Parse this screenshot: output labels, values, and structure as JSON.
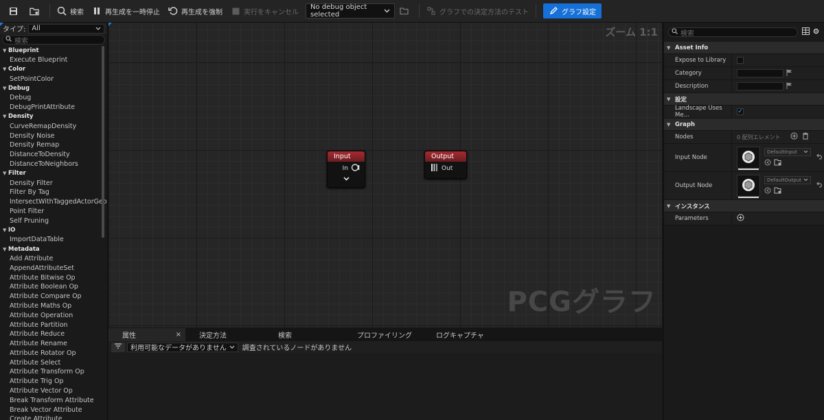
{
  "toolbar": {
    "search_label": "検索",
    "pause_label": "再生成を一時停止",
    "force_label": "再生成を強制",
    "cancel_label": "実行をキャンセル",
    "debug_object": "No debug object selected",
    "test_label": "グラフでの決定方法のテスト",
    "graph_settings_label": "グラフ設定"
  },
  "palette": {
    "type_label": "タイプ:",
    "type_value": "All",
    "search_placeholder": "検索",
    "categories": [
      {
        "name": "Blueprint",
        "items": [
          "Execute Blueprint"
        ]
      },
      {
        "name": "Color",
        "items": [
          "SetPointColor"
        ]
      },
      {
        "name": "Debug",
        "items": [
          "Debug",
          "DebugPrintAttribute"
        ]
      },
      {
        "name": "Density",
        "items": [
          "CurveRemapDensity",
          "Density Noise",
          "Density Remap",
          "DistanceToDensity",
          "DistanceToNeighbors"
        ]
      },
      {
        "name": "Filter",
        "items": [
          "Density Filter",
          "Filter By Tag",
          "IntersectWithTaggedActorGeo",
          "Point Filter",
          "Self Pruning"
        ]
      },
      {
        "name": "IO",
        "items": [
          "ImportDataTable"
        ]
      },
      {
        "name": "Metadata",
        "items": [
          "Add Attribute",
          "AppendAttributeSet",
          "Attribute Bitwise Op",
          "Attribute Boolean Op",
          "Attribute Compare Op",
          "Attribute Maths Op",
          "Attribute Operation",
          "Attribute Partition",
          "Attribute Reduce",
          "Attribute Rename",
          "Attribute Rotator Op",
          "Attribute Select",
          "Attribute Transform Op",
          "Attribute Trig Op",
          "Attribute Vector Op",
          "Break Transform Attribute",
          "Break Vector Attribute",
          "Create Attribute"
        ]
      }
    ]
  },
  "graph": {
    "zoom": "ズーム 1:1",
    "watermark": "PCGグラフ",
    "input_node": {
      "title": "Input",
      "pin": "In"
    },
    "output_node": {
      "title": "Output",
      "pin": "Out"
    }
  },
  "bottom": {
    "tabs": [
      "属性",
      "決定方法",
      "検索",
      "プロファイリング",
      "ログキャプチャ"
    ],
    "close": "×",
    "data_select": "利用可能なデータがありません",
    "no_node": "調査されているノードがありません"
  },
  "details": {
    "search_placeholder": "検索",
    "asset_info": "Asset Info",
    "expose_label": "Expose to Library",
    "category_label": "Category",
    "description_label": "Description",
    "settings_section": "設定",
    "landscape_label": "Landscape Uses Me...",
    "graph_section": "Graph",
    "nodes_label": "Nodes",
    "nodes_value": "0 配列エレメント",
    "input_node_label": "Input Node",
    "input_node_value": "DefaultInput",
    "output_node_label": "Output Node",
    "output_node_value": "DefaultOutput",
    "instance_section": "インスタンス",
    "parameters_label": "Parameters"
  },
  "colors": {
    "accent": "#1570d8",
    "node_header": "#a82a30",
    "check": "#3fa0ff"
  }
}
